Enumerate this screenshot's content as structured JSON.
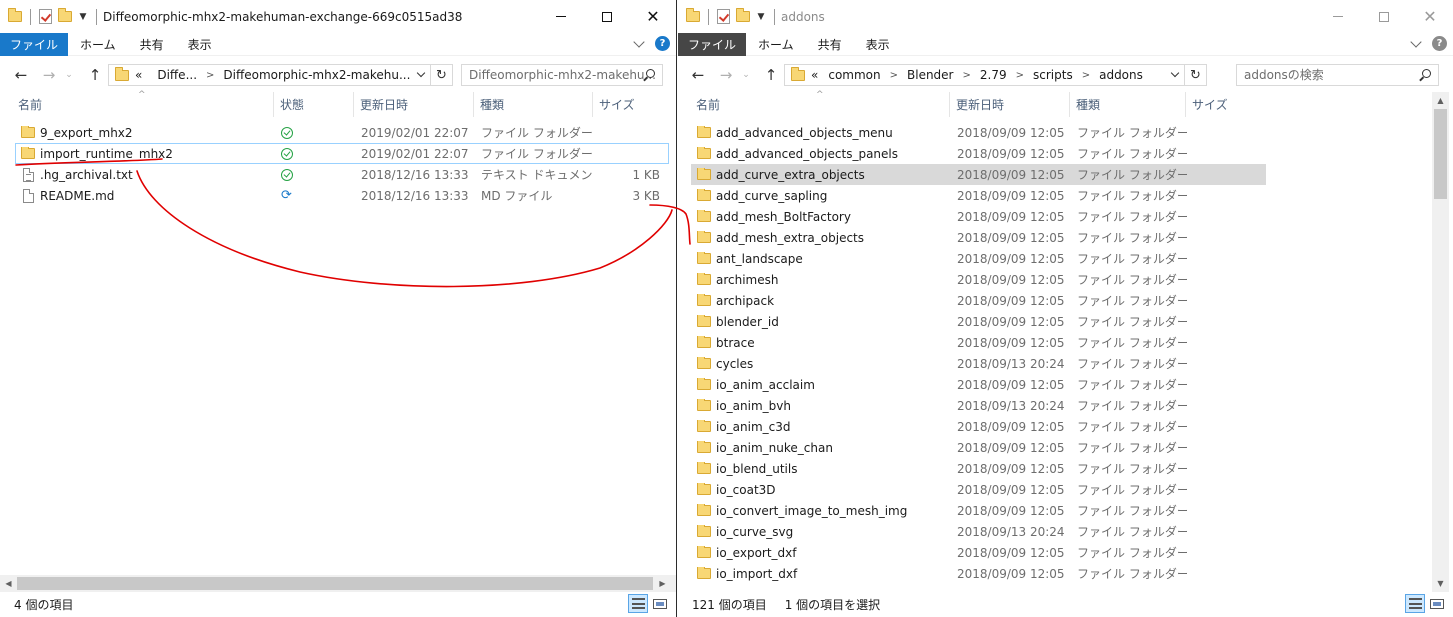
{
  "left_window": {
    "title": "Diffeomorphic-mhx2-makehuman-exchange-669c0515ad38",
    "ribbon_tabs": [
      "ファイル",
      "ホーム",
      "共有",
      "表示"
    ],
    "address": {
      "overflow": "«",
      "crumbs": [
        "Diffe...",
        "Diffeomorphic-mhx2-makehu..."
      ]
    },
    "search_placeholder": "Diffeomorphic-mhx2-makehu...",
    "columns": {
      "name": "名前",
      "status": "状態",
      "date": "更新日時",
      "type": "種類",
      "size": "サイズ"
    },
    "items": [
      {
        "name": "9_export_mhx2",
        "icon": "folder-icon",
        "status": "synced",
        "date": "2019/02/01 22:07",
        "type": "ファイル フォルダー",
        "size": ""
      },
      {
        "name": "import_runtime_mhx2",
        "icon": "folder-icon",
        "status": "synced",
        "date": "2019/02/01 22:07",
        "type": "ファイル フォルダー",
        "size": ""
      },
      {
        "name": ".hg_archival.txt",
        "icon": "text-file-icon",
        "status": "synced",
        "date": "2018/12/16 13:33",
        "type": "テキスト ドキュメント",
        "size": "1 KB"
      },
      {
        "name": "README.md",
        "icon": "file-icon",
        "status": "syncing",
        "date": "2018/12/16 13:33",
        "type": "MD ファイル",
        "size": "3 KB"
      }
    ],
    "status_bar": "4 個の項目"
  },
  "right_window": {
    "title": "addons",
    "ribbon_tabs": [
      "ファイル",
      "ホーム",
      "共有",
      "表示"
    ],
    "address": {
      "overflow": "«",
      "crumbs": [
        "common",
        "Blender",
        "2.79",
        "scripts",
        "addons"
      ]
    },
    "search_placeholder": "addonsの検索",
    "columns": {
      "name": "名前",
      "date": "更新日時",
      "type": "種類",
      "size": "サイズ"
    },
    "items": [
      {
        "name": "add_advanced_objects_menu",
        "date": "2018/09/09 12:05",
        "type": "ファイル フォルダー"
      },
      {
        "name": "add_advanced_objects_panels",
        "date": "2018/09/09 12:05",
        "type": "ファイル フォルダー"
      },
      {
        "name": "add_curve_extra_objects",
        "date": "2018/09/09 12:05",
        "type": "ファイル フォルダー"
      },
      {
        "name": "add_curve_sapling",
        "date": "2018/09/09 12:05",
        "type": "ファイル フォルダー"
      },
      {
        "name": "add_mesh_BoltFactory",
        "date": "2018/09/09 12:05",
        "type": "ファイル フォルダー"
      },
      {
        "name": "add_mesh_extra_objects",
        "date": "2018/09/09 12:05",
        "type": "ファイル フォルダー"
      },
      {
        "name": "ant_landscape",
        "date": "2018/09/09 12:05",
        "type": "ファイル フォルダー"
      },
      {
        "name": "archimesh",
        "date": "2018/09/09 12:05",
        "type": "ファイル フォルダー"
      },
      {
        "name": "archipack",
        "date": "2018/09/09 12:05",
        "type": "ファイル フォルダー"
      },
      {
        "name": "blender_id",
        "date": "2018/09/09 12:05",
        "type": "ファイル フォルダー"
      },
      {
        "name": "btrace",
        "date": "2018/09/09 12:05",
        "type": "ファイル フォルダー"
      },
      {
        "name": "cycles",
        "date": "2018/09/13 20:24",
        "type": "ファイル フォルダー"
      },
      {
        "name": "io_anim_acclaim",
        "date": "2018/09/09 12:05",
        "type": "ファイル フォルダー"
      },
      {
        "name": "io_anim_bvh",
        "date": "2018/09/13 20:24",
        "type": "ファイル フォルダー"
      },
      {
        "name": "io_anim_c3d",
        "date": "2018/09/09 12:05",
        "type": "ファイル フォルダー"
      },
      {
        "name": "io_anim_nuke_chan",
        "date": "2018/09/09 12:05",
        "type": "ファイル フォルダー"
      },
      {
        "name": "io_blend_utils",
        "date": "2018/09/09 12:05",
        "type": "ファイル フォルダー"
      },
      {
        "name": "io_coat3D",
        "date": "2018/09/09 12:05",
        "type": "ファイル フォルダー"
      },
      {
        "name": "io_convert_image_to_mesh_img",
        "date": "2018/09/09 12:05",
        "type": "ファイル フォルダー"
      },
      {
        "name": "io_curve_svg",
        "date": "2018/09/13 20:24",
        "type": "ファイル フォルダー"
      },
      {
        "name": "io_export_dxf",
        "date": "2018/09/09 12:05",
        "type": "ファイル フォルダー"
      },
      {
        "name": "io_import_dxf",
        "date": "2018/09/09 12:05",
        "type": "ファイル フォルダー"
      }
    ],
    "status_count": "121 個の項目",
    "status_selected": "1 個の項目を選択"
  },
  "colors": {
    "file_tab_active": "#1979ca",
    "file_tab_inactive": "#464646",
    "annotation": "#e00000",
    "sync_ok": "#25a244",
    "sync_pending": "#1979ca"
  }
}
